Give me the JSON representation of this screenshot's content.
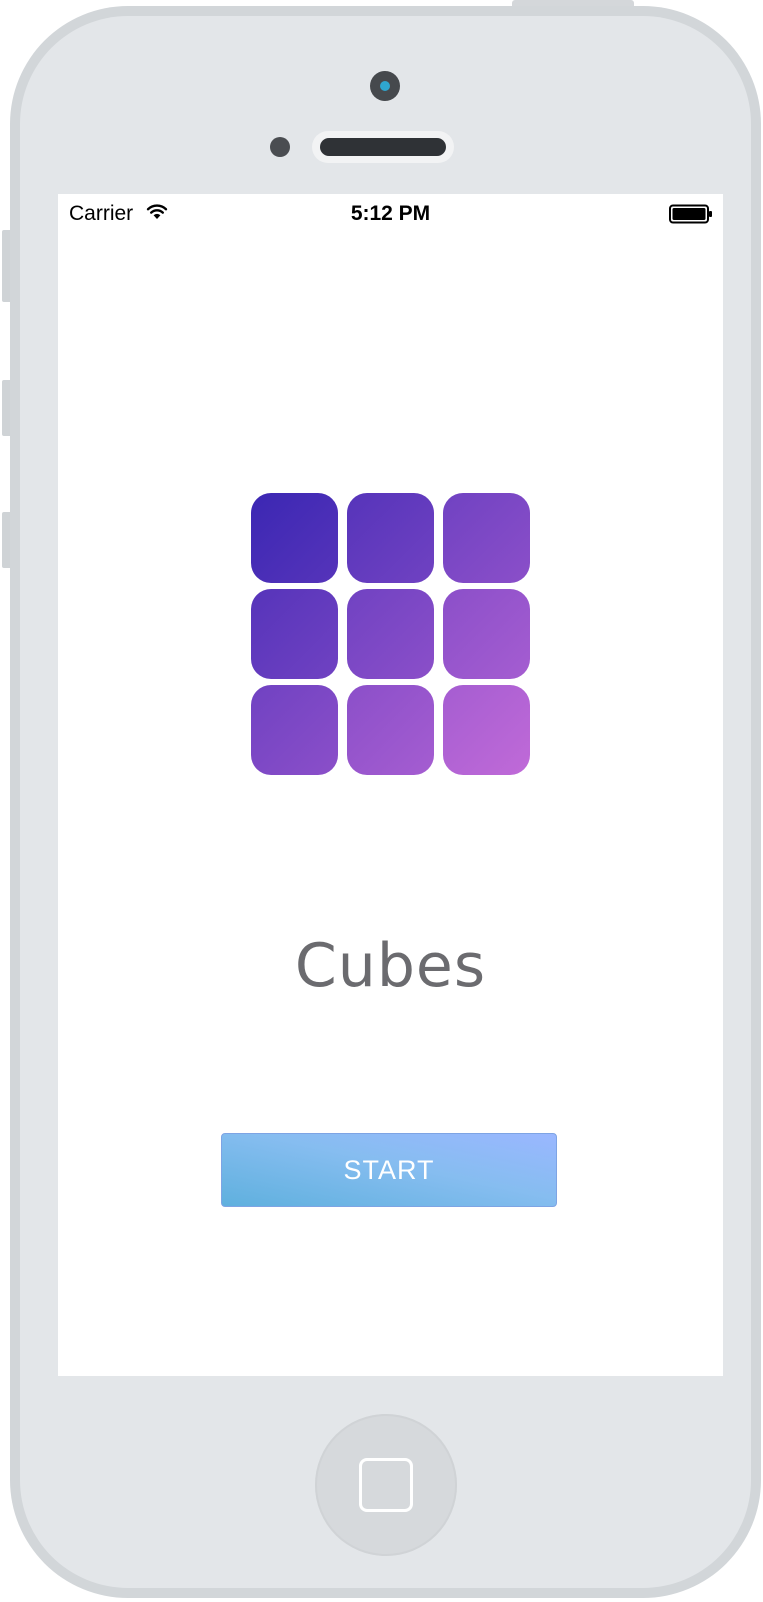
{
  "status_bar": {
    "carrier": "Carrier",
    "time": "5:12 PM",
    "wifi_icon": "wifi-icon",
    "battery_icon": "battery-full-icon"
  },
  "logo": {
    "icon": "cubes-grid-logo",
    "start_color": "#3b27b3",
    "end_color": "#c06ad8"
  },
  "app": {
    "title": "Cubes",
    "start_label": "START"
  },
  "device": {
    "home_button_icon": "home-button-square-icon"
  },
  "colors": {
    "button_gradient_from": "#5fb0de",
    "button_gradient_to": "#9ab7ff",
    "title_color": "#5b5c60"
  }
}
